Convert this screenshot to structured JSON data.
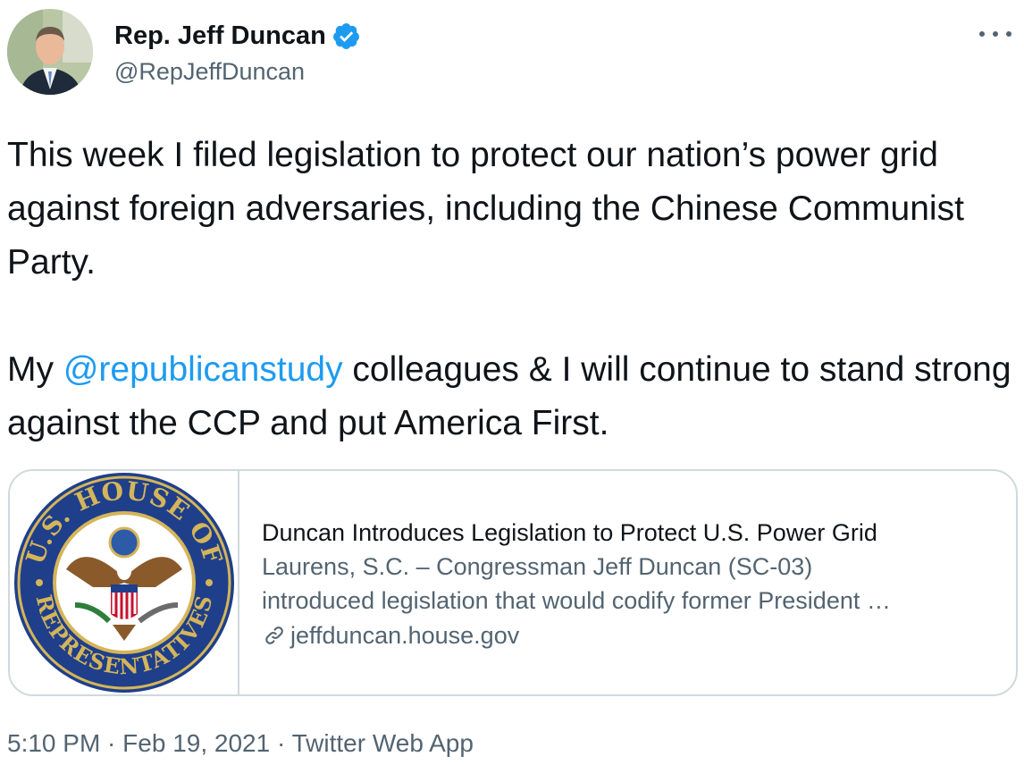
{
  "author": {
    "name": "Rep. Jeff Duncan",
    "handle": "@RepJeffDuncan",
    "verified": true,
    "avatar_icon": "profile-photo",
    "verified_color": "#1d9bf0"
  },
  "tweet": {
    "paragraph1": "This week I filed legislation to protect our nation’s power grid against foreign adversaries, including the Chinese Communist Party.",
    "p2_before": "My ",
    "p2_mention": "@republicanstudy",
    "p2_after": " colleagues & I will continue to stand strong against the CCP and put America First."
  },
  "card": {
    "image_icon": "us-house-of-representatives-seal",
    "seal_text_top": "U.S. HOUSE OF",
    "seal_text_bottom": "REPRESENTATIVES",
    "title": "Duncan Introduces Legislation to Protect U.S. Power Grid",
    "description_line1": "Laurens, S.C. – Congressman Jeff Duncan (SC-03)",
    "description_line2": "introduced legislation that would codify former President …",
    "link_icon": "link-icon",
    "domain": "jeffduncan.house.gov"
  },
  "meta": {
    "time": "5:10 PM",
    "date": "Feb 19, 2021",
    "separator": " · ",
    "source": "Twitter Web App"
  },
  "colors": {
    "text": "#0f1419",
    "secondary": "#536471",
    "accent": "#1d9bf0",
    "border": "#cfd9de"
  }
}
